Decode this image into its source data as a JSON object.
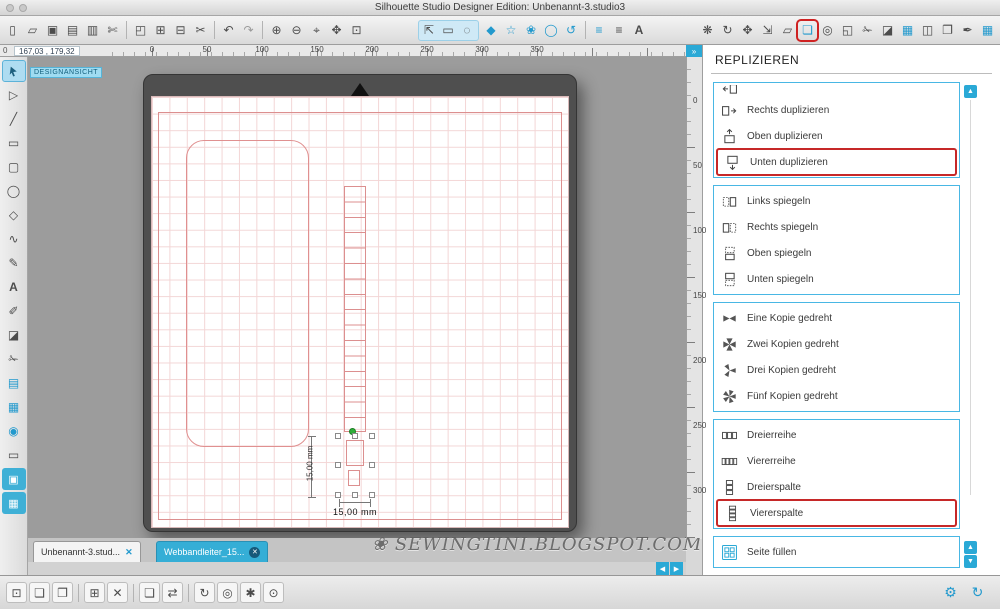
{
  "window": {
    "title": "Silhouette Studio Designer Edition: Unbenannt-3.studio3"
  },
  "statusbar": {
    "origin": "0",
    "coordinates": "167,03 , 179,32"
  },
  "view_label": "DESIGNANSICHT",
  "rulers": {
    "horizontal": [
      "0",
      "50",
      "100",
      "150",
      "200",
      "250",
      "300",
      "350"
    ],
    "vertical": [
      "0",
      "50",
      "100",
      "150",
      "200",
      "250",
      "300"
    ]
  },
  "canvas": {
    "measure_vertical": "15,00 mm",
    "measure_horizontal": "15,00 mm",
    "watermark": "SEWINGTINI.BLOGSPOT.COM"
  },
  "tabs": [
    {
      "label": "Unbenannt-3.stud...",
      "close": "✕",
      "active": true
    },
    {
      "label": "Webbandleiter_15...",
      "close": "✕",
      "active": false
    }
  ],
  "replicate_panel": {
    "title": "REPLIZIEREN",
    "groups": [
      {
        "items": [
          {
            "label": "Rechts duplizieren",
            "icon": "duplicate-right",
            "highlighted": false
          },
          {
            "label": "Oben duplizieren",
            "icon": "duplicate-up",
            "highlighted": false
          },
          {
            "label": "Unten duplizieren",
            "icon": "duplicate-down",
            "highlighted": true
          }
        ]
      },
      {
        "items": [
          {
            "label": "Links spiegeln",
            "icon": "mirror-left",
            "highlighted": false
          },
          {
            "label": "Rechts spiegeln",
            "icon": "mirror-right",
            "highlighted": false
          },
          {
            "label": "Oben spiegeln",
            "icon": "mirror-up",
            "highlighted": false
          },
          {
            "label": "Unten spiegeln",
            "icon": "mirror-down",
            "highlighted": false
          }
        ]
      },
      {
        "items": [
          {
            "label": "Eine Kopie gedreht",
            "icon": "rotate-one-copy",
            "highlighted": false
          },
          {
            "label": "Zwei Kopien gedreht",
            "icon": "rotate-two-copies",
            "highlighted": false
          },
          {
            "label": "Drei Kopien gedreht",
            "icon": "rotate-three-copies",
            "highlighted": false
          },
          {
            "label": "Fünf Kopien gedreht",
            "icon": "rotate-five-copies",
            "highlighted": false
          }
        ]
      },
      {
        "items": [
          {
            "label": "Dreierreihe",
            "icon": "row-of-three",
            "highlighted": false
          },
          {
            "label": "Viererreihe",
            "icon": "row-of-four",
            "highlighted": false
          },
          {
            "label": "Dreierspalte",
            "icon": "column-of-three",
            "highlighted": false
          },
          {
            "label": "Viererspalte",
            "icon": "column-of-four",
            "highlighted": true
          }
        ]
      },
      {
        "items": [
          {
            "label": "Seite füllen",
            "icon": "fill-page",
            "highlighted": false
          }
        ]
      }
    ]
  },
  "colors": {
    "accent": "#2aa9d6",
    "highlight_box": "#c62828",
    "grid_line": "#f3d6d6"
  },
  "icons": {
    "new-document": "▯",
    "open": "▱",
    "save": "▣",
    "save-library": "▤",
    "print": "▥",
    "send-to-silhouette": "✄",
    "trace": "◰",
    "copy": "⊞",
    "paste": "⊟",
    "cut": "✂",
    "undo": "↶",
    "redo": "↷",
    "zoom-in": "⊕",
    "zoom-out": "⊖",
    "zoom-drag": "⌖",
    "pan": "✥",
    "fit-page": "⊡",
    "select": "⇱",
    "select-rect": "▭",
    "lasso": "◌",
    "shape-pentagon": "◆",
    "shape-star": "☆",
    "shape-flower": "❀",
    "shape-circle": "◯",
    "shape-wave": "∿",
    "shape-spiral": "↺",
    "line-weight": "≡",
    "line-style": "≡",
    "text-style": "A",
    "effects": "❋",
    "rotate-panel": "↻",
    "move-panel": "✥",
    "scale-panel": "⇲",
    "shear-panel": "▱",
    "replicate-panel": "❏",
    "offset-panel": "◎",
    "modify-panel": "◱",
    "knife-panel": "✁",
    "eraser-panel": "◪",
    "pixscan": "▦",
    "layers-panel": "◫",
    "pages-panel": "❐",
    "pen-color": "✒",
    "grid-panel": "▦",
    "send-panel": "➔",
    "tool-point-edit": "▷",
    "tool-line": "╱",
    "tool-rect": "▭",
    "tool-rounded-rect": "▢",
    "tool-ellipse": "◯",
    "tool-polygon": "◇",
    "tool-curve": "∿",
    "tool-draw": "✎",
    "tool-text": "A",
    "tool-notes": "✐",
    "tool-eraser": "◪",
    "tool-knife": "✁",
    "page-setup": "▤",
    "mat-setup": "▦",
    "online-store": "◉",
    "window-tool": "▭",
    "page-thumb": "▣",
    "page-thumb2": "▦",
    "bottom-select-all": "⊡",
    "bottom-group": "❏",
    "bottom-ungroup": "❐",
    "bottom-copy": "⊞",
    "bottom-delete": "✕",
    "bottom-duplicate": "❏",
    "bottom-mirror": "⇄",
    "bottom-rotate": "↻",
    "bottom-center": "◎",
    "bottom-weld": "✱",
    "bottom-attach": "⊙",
    "gear": "⚙",
    "sync": "↻",
    "scroll-up": "▲",
    "scroll-down": "▼",
    "scroll-left": "◀",
    "scroll-right": "▶",
    "panel-expand": "»",
    "flourish": "❀"
  }
}
